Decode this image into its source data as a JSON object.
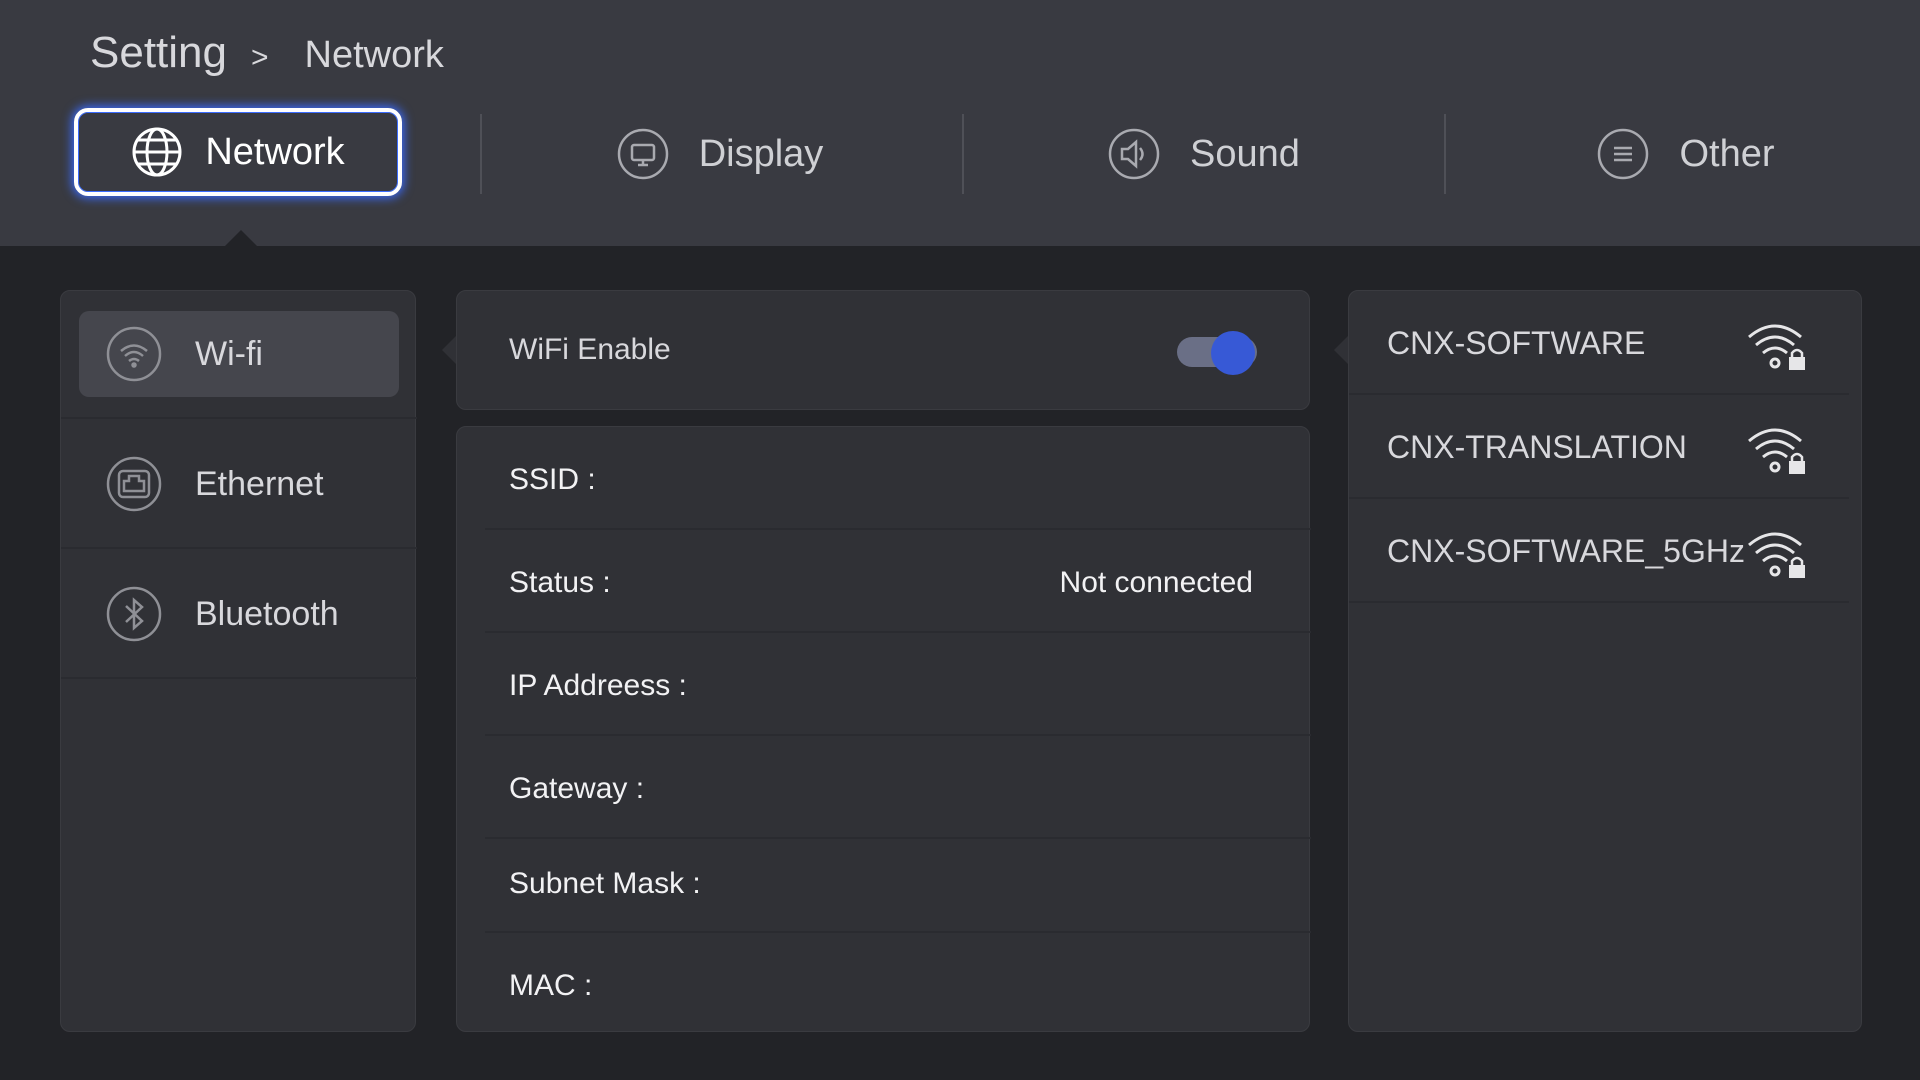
{
  "breadcrumb": {
    "root": "Setting",
    "separator": ">",
    "current": "Network"
  },
  "tabs": [
    {
      "label": "Network",
      "icon": "globe-icon",
      "active": true
    },
    {
      "label": "Display",
      "icon": "monitor-icon",
      "active": false
    },
    {
      "label": "Sound",
      "icon": "speaker-icon",
      "active": false
    },
    {
      "label": "Other",
      "icon": "menu-icon",
      "active": false
    }
  ],
  "sidebar": {
    "items": [
      {
        "label": "Wi-fi",
        "icon": "wifi-icon",
        "selected": true
      },
      {
        "label": "Ethernet",
        "icon": "ethernet-icon",
        "selected": false
      },
      {
        "label": "Bluetooth",
        "icon": "bluetooth-icon",
        "selected": false
      }
    ]
  },
  "wifi_enable": {
    "label": "WiFi Enable",
    "enabled": true
  },
  "info": {
    "rows": [
      {
        "label": "SSID :",
        "value": ""
      },
      {
        "label": "Status :",
        "value": "Not connected"
      },
      {
        "label": "IP Addreess :",
        "value": ""
      },
      {
        "label": "Gateway :",
        "value": ""
      },
      {
        "label": "Subnet Mask :",
        "value": ""
      },
      {
        "label": "MAC :",
        "value": ""
      }
    ]
  },
  "networks": [
    {
      "ssid": "CNX-SOFTWARE",
      "icon": "wifi-lock-icon",
      "secured": true
    },
    {
      "ssid": "CNX-TRANSLATION",
      "icon": "wifi-lock-icon",
      "secured": true
    },
    {
      "ssid": "CNX-SOFTWARE_5GHz",
      "icon": "wifi-lock-icon",
      "secured": true
    }
  ],
  "colors": {
    "accent": "#3759d6",
    "topbar": "#393a41",
    "background": "#222327",
    "panel": "#303136"
  }
}
